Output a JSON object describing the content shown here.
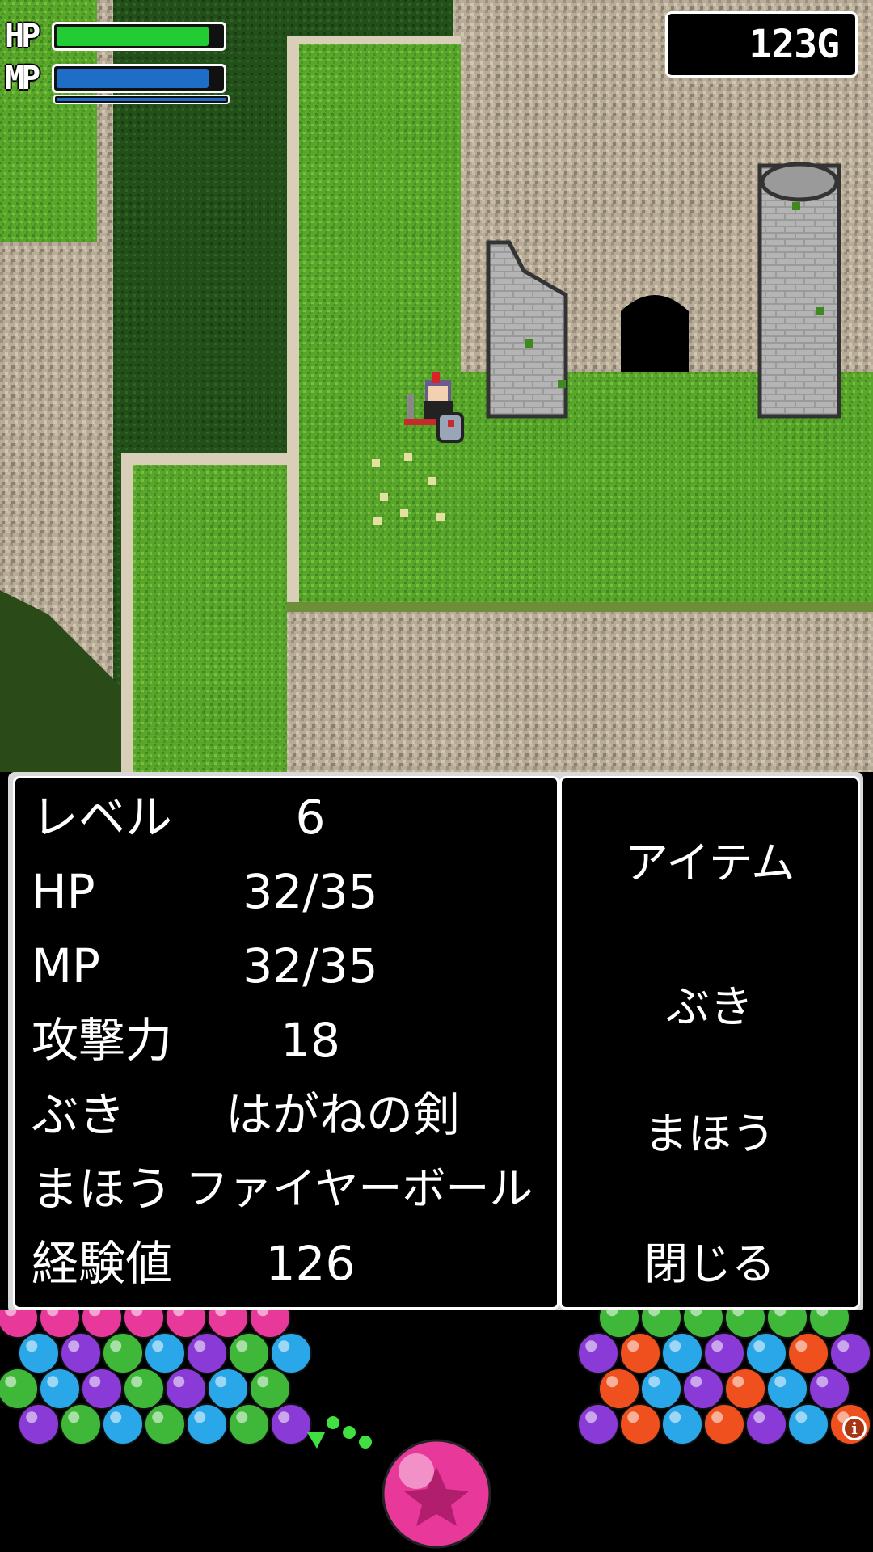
{
  "hud": {
    "hp_label": "HP",
    "mp_label": "MP",
    "hp_fill": 0.92,
    "mp_fill": 0.92,
    "hp_color": "#22cc33",
    "mp_color": "#1e6ec8",
    "gold": "123G"
  },
  "status": {
    "rows": [
      {
        "label": "レベル",
        "value": "6"
      },
      {
        "label": "HP",
        "value": "32/35"
      },
      {
        "label": "MP",
        "value": "32/35"
      },
      {
        "label": "攻撃力",
        "value": "18"
      },
      {
        "label": "ぶき",
        "value": "はがねの剣"
      },
      {
        "label": "まほう",
        "value": "ファイヤーボール"
      },
      {
        "label": "経験値",
        "value": "126"
      }
    ]
  },
  "commands": [
    {
      "label": "アイテム"
    },
    {
      "label": "ぶき"
    },
    {
      "label": "まほう"
    },
    {
      "label": "閉じる"
    }
  ],
  "puzzle": {
    "info_icon": "i",
    "orb_colors": {
      "pink": "#e8389a",
      "blue": "#29a7e8",
      "green": "#3fb83a",
      "purple": "#8a3ad6",
      "red": "#f0501e"
    },
    "shooter_color": "pink"
  }
}
